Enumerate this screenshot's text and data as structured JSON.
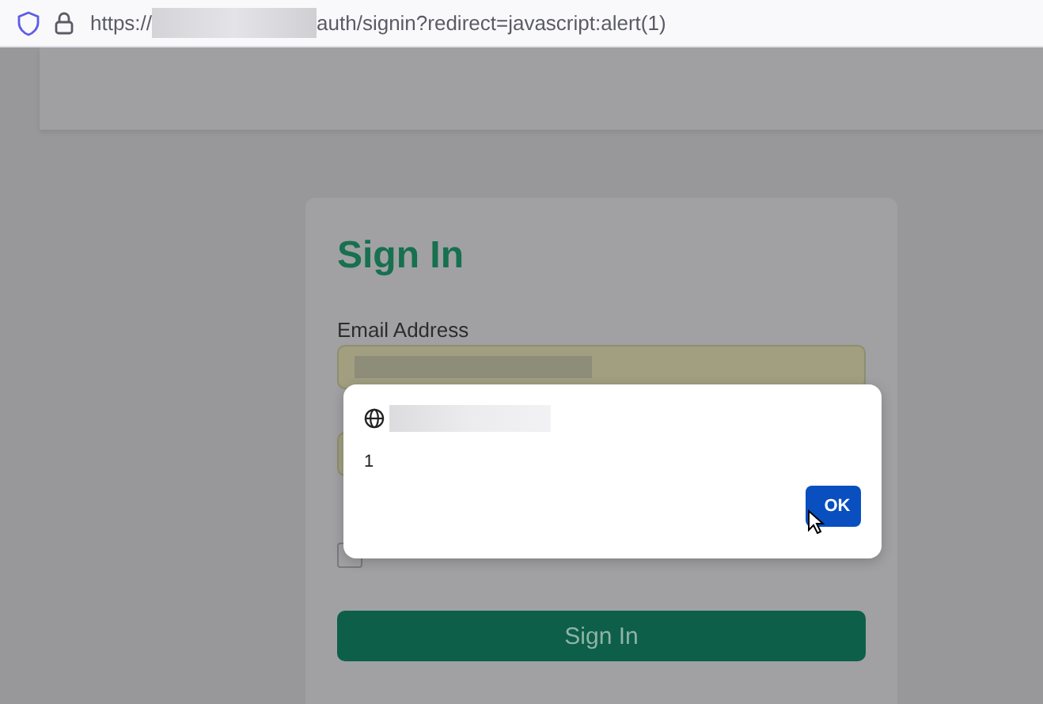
{
  "address_bar": {
    "url_start": "https://",
    "url_end": "auth/signin?redirect=javascript:alert(1)"
  },
  "signin": {
    "title": "Sign In",
    "email_label": "Email Address",
    "remember_checked": false,
    "submit": "Sign In"
  },
  "alert": {
    "message": "1",
    "button": "OK"
  }
}
